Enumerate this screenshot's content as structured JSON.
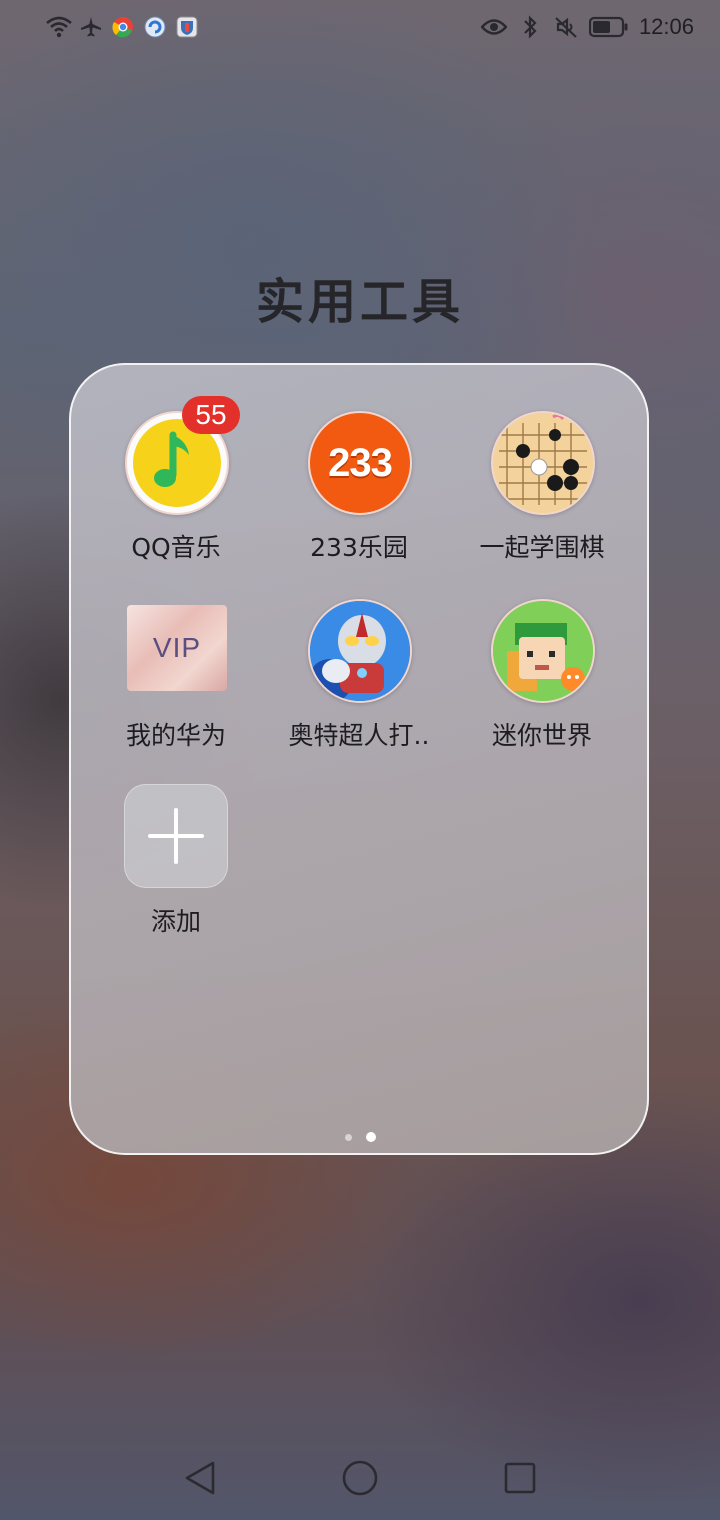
{
  "status_bar": {
    "time": "12:06",
    "left_icons": [
      "wifi-icon",
      "airplane-icon",
      "chrome-icon",
      "browser-icon",
      "shield-app-icon"
    ],
    "right_icons": [
      "eye-icon",
      "bluetooth-icon",
      "mute-icon",
      "battery-icon"
    ]
  },
  "folder": {
    "title": "实用工具",
    "apps": [
      {
        "label": "QQ音乐",
        "icon": "qq-music-icon",
        "badge": "55"
      },
      {
        "label": "233乐园",
        "icon": "233-icon",
        "icon_text": "233"
      },
      {
        "label": "一起学围棋",
        "icon": "go-game-icon"
      },
      {
        "label": "我的华为",
        "icon": "my-huawei-icon",
        "icon_text": "VIP"
      },
      {
        "label": "奥特超人打..",
        "icon": "ultraman-icon"
      },
      {
        "label": "迷你世界",
        "icon": "mini-world-icon"
      },
      {
        "label": "添加",
        "icon": "add-icon"
      }
    ],
    "page_count": 2,
    "active_page": 2
  },
  "nav": {
    "back": "back-icon",
    "home": "home-icon",
    "recents": "recents-icon"
  },
  "colors": {
    "badge": "#e3302a",
    "qq_yellow": "#f6d21a",
    "qq_green": "#2fb75a",
    "orange_233": "#f25a12"
  }
}
